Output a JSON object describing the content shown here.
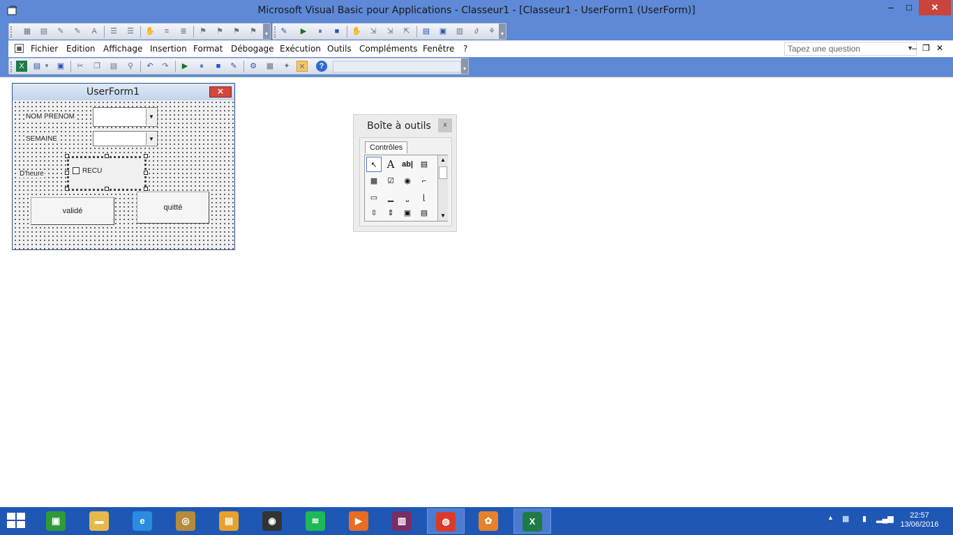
{
  "window": {
    "title": "Microsoft Visual Basic pour Applications - Classeur1 - [Classeur1 - UserForm1 (UserForm)]",
    "minimize": "‒",
    "maximize": "□",
    "close": "✕"
  },
  "menu": {
    "items": [
      "Fichier",
      "Edition",
      "Affichage",
      "Insertion",
      "Format",
      "Débogage",
      "Exécution",
      "Outils",
      "Compléments",
      "Fenêtre",
      "?"
    ],
    "ask_placeholder": "Tapez une question",
    "mdi_min": "‒",
    "mdi_restore": "❐",
    "mdi_close": "✕"
  },
  "userform": {
    "title": "UserForm1",
    "close": "✕",
    "label_nom": "NOM PRENOM",
    "label_semaine": "SEMAINE",
    "label_heure": "D'heure",
    "checkbox_label": "RECU",
    "button_valide": "validé",
    "button_quitte": "quitté"
  },
  "toolbox": {
    "title": "Boîte à outils",
    "close": "x",
    "tab": "Contrôles",
    "tools": [
      {
        "name": "pointer-tool",
        "glyph": "↖"
      },
      {
        "name": "label-tool",
        "glyph": "A"
      },
      {
        "name": "textbox-tool",
        "glyph": "ab|"
      },
      {
        "name": "combobox-tool",
        "glyph": "▤"
      },
      {
        "name": "listbox-tool",
        "glyph": "▦"
      },
      {
        "name": "checkbox-tool",
        "glyph": "☑"
      },
      {
        "name": "optionbutton-tool",
        "glyph": "◉"
      },
      {
        "name": "togglebutton-tool",
        "glyph": "⌐"
      },
      {
        "name": "frame-tool",
        "glyph": "▭"
      },
      {
        "name": "commandbutton-tool",
        "glyph": "▁"
      },
      {
        "name": "tabstrip-tool",
        "glyph": "⎵"
      },
      {
        "name": "multipage-tool",
        "glyph": "⌊"
      },
      {
        "name": "scrollbar-tool",
        "glyph": "⇳"
      },
      {
        "name": "spinbutton-tool",
        "glyph": "⇕"
      },
      {
        "name": "image-tool",
        "glyph": "▣"
      },
      {
        "name": "refedit-tool",
        "glyph": "▤"
      }
    ]
  },
  "taskbar": {
    "apps": [
      {
        "name": "store",
        "glyph": "▣",
        "color": "#2f9a3a"
      },
      {
        "name": "file-explorer",
        "glyph": "▬",
        "color": "#e8b84a"
      },
      {
        "name": "internet-explorer",
        "glyph": "e",
        "color": "#2a8ce0"
      },
      {
        "name": "app-gold",
        "glyph": "◎",
        "color": "#b58b3c"
      },
      {
        "name": "notes-app",
        "glyph": "▤",
        "color": "#e7a12a"
      },
      {
        "name": "speaker-app",
        "glyph": "◉",
        "color": "#333333"
      },
      {
        "name": "spotify",
        "glyph": "≋",
        "color": "#1db954"
      },
      {
        "name": "media-player",
        "glyph": "▶",
        "color": "#e86c23"
      },
      {
        "name": "winrar",
        "glyph": "▥",
        "color": "#7b2e66"
      },
      {
        "name": "chrome",
        "glyph": "◍",
        "color": "#d93b2b"
      },
      {
        "name": "fl-studio",
        "glyph": "✿",
        "color": "#e8822a"
      },
      {
        "name": "excel",
        "glyph": "X",
        "color": "#1e7b45"
      }
    ],
    "time": "22:57",
    "date": "13/06/2016"
  },
  "colors": {
    "titlebar": "#5d89d6",
    "taskbar": "#1f57b5",
    "close_button": "#c9443a"
  }
}
